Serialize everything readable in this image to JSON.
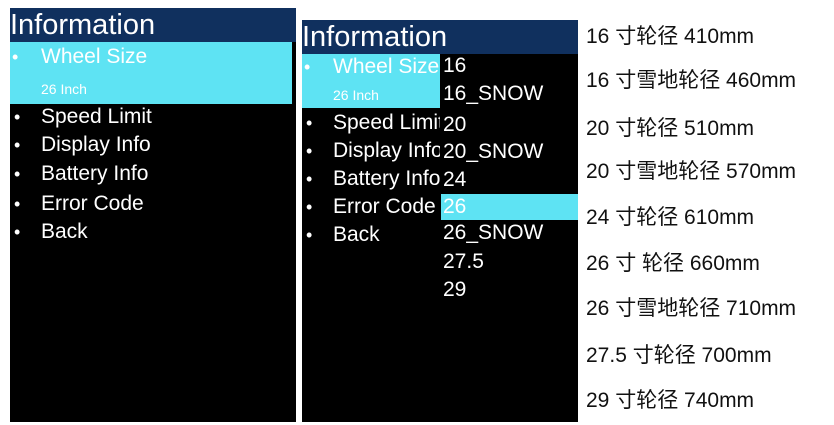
{
  "screen1": {
    "title": "Information",
    "selected": {
      "label": "Wheel Size",
      "value": "26 Inch"
    },
    "items": [
      "Speed Limit",
      "Display Info",
      "Battery Info",
      "Error Code",
      "Back"
    ]
  },
  "screen2": {
    "title": "Information",
    "selected": {
      "label": "Wheel Size",
      "value": "26 Inch"
    },
    "items": [
      "Speed Limit",
      "Display Info",
      "Battery Info",
      "Error Code",
      "Back"
    ],
    "options": [
      "16",
      "16_SNOW",
      "20",
      "20_SNOW",
      "24",
      "26",
      "26_SNOW",
      "27.5",
      "29"
    ],
    "selected_option": "26"
  },
  "legend": [
    "16 寸轮径 410mm",
    "16 寸雪地轮径 460mm",
    "20 寸轮径 510mm",
    "20 寸雪地轮径 570mm",
    "24 寸轮径 610mm",
    "26 寸  轮径 660mm",
    "26 寸雪地轮径 710mm",
    "27.5 寸轮径 700mm",
    "29 寸轮径 740mm"
  ],
  "colors": {
    "title_bg": "#10305e",
    "highlight": "#5ee3f3",
    "screen_bg": "#000000"
  },
  "bullet_glyph": "•"
}
